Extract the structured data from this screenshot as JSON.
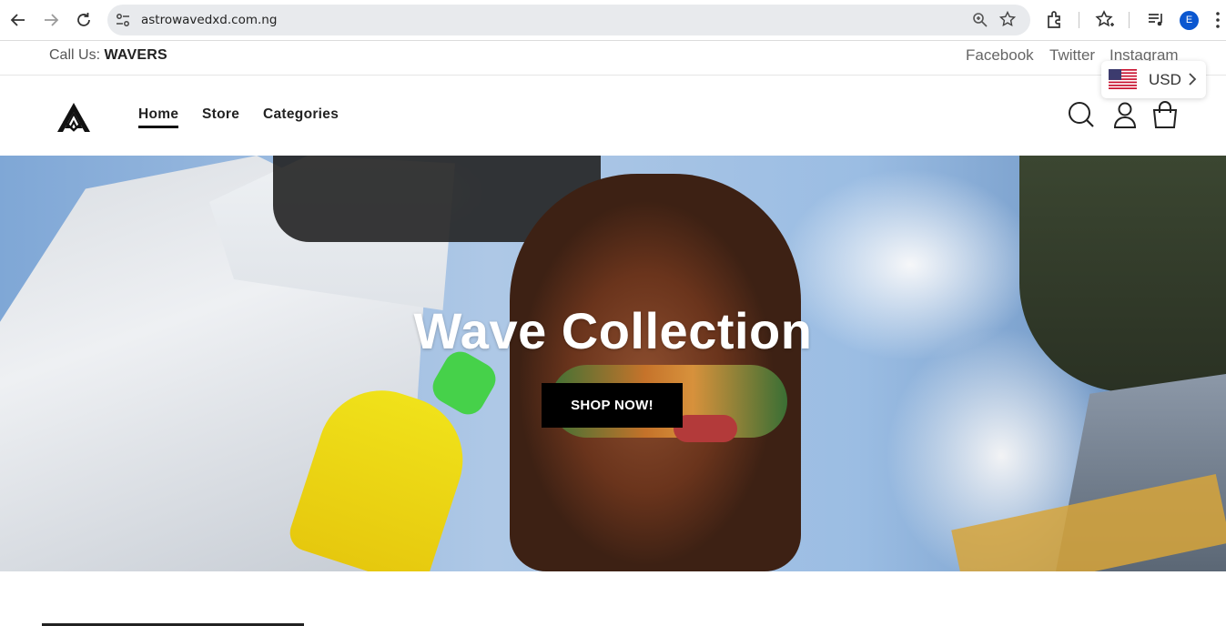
{
  "browser": {
    "url": "astrowavedxd.com.ng",
    "profile_initial": "E",
    "icons": [
      "back-arrow-icon",
      "forward-arrow-icon",
      "reload-icon",
      "site-info-icon",
      "zoom-icon",
      "bookmark-star-icon",
      "extensions-icon",
      "reading-list-icon",
      "media-control-icon",
      "menu-kebab-icon"
    ]
  },
  "topbar": {
    "call_prefix": "Call Us:",
    "call_value": "WAVERS",
    "social": [
      "Facebook",
      "Twitter",
      "Instagram"
    ]
  },
  "header": {
    "nav": [
      "Home",
      "Store",
      "Categories"
    ],
    "active_nav": "Home",
    "icons": [
      "search-icon",
      "account-icon",
      "cart-bag-icon"
    ]
  },
  "currency": {
    "code": "USD",
    "flag": "us-flag-icon"
  },
  "hero": {
    "title": "Wave Collection",
    "button": "SHOP NOW!"
  },
  "colors": {
    "button_bg": "#000000",
    "button_text": "#ffffff",
    "profile_bg": "#0b57d0"
  }
}
